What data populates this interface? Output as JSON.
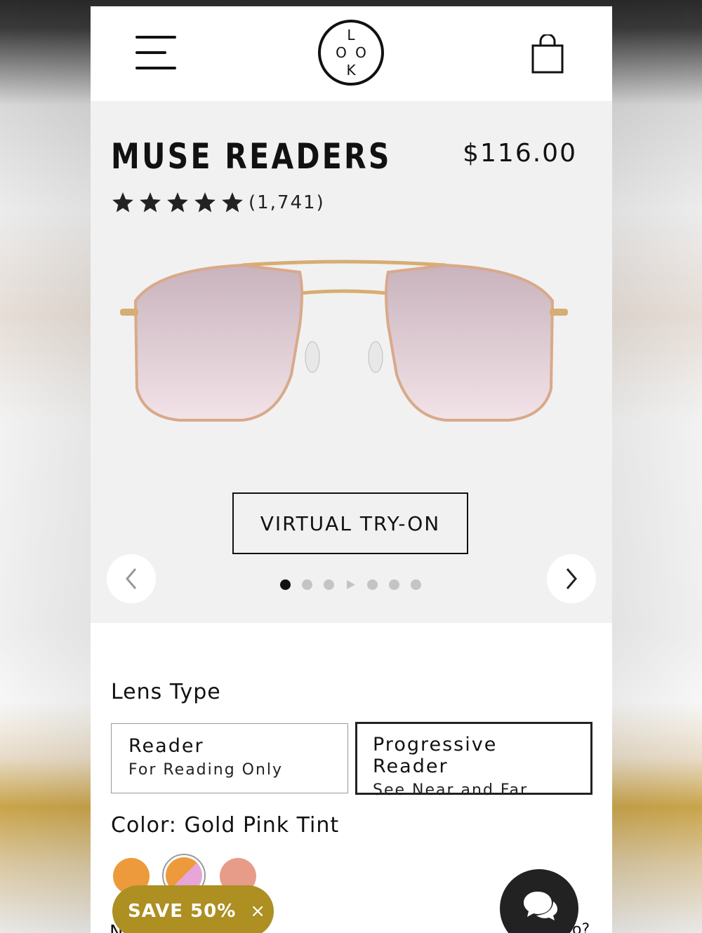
{
  "product": {
    "title": "MUSE READERS",
    "price": "$116.00",
    "rating_stars": 5,
    "review_count": "(1,741)"
  },
  "hero": {
    "tryon_label": "VIRTUAL TRY-ON",
    "carousel": {
      "slide_count": 7,
      "active_index": 0,
      "video_slide_index": 3
    }
  },
  "lens": {
    "label": "Lens Type",
    "options": [
      {
        "title": "Reader",
        "subtitle": "For Reading Only",
        "selected": false
      },
      {
        "title": "Progressive Reader",
        "subtitle": "See Near and Far",
        "selected": true
      }
    ]
  },
  "color": {
    "label": "Color:",
    "value": "Gold Pink Tint",
    "swatches": [
      {
        "name": "gold",
        "color": "#ec9a3c",
        "selected": false
      },
      {
        "name": "gold-pink-tint",
        "color": "#e7a6d7",
        "selected": true
      },
      {
        "name": "rose",
        "color": "#e79c8a",
        "selected": false
      }
    ]
  },
  "promo": {
    "label": "SAVE 50%",
    "close": "×"
  },
  "peek": {
    "left": "N",
    "right": "o?"
  },
  "icons": {
    "menu": "menu-icon",
    "logo_letters": [
      "L",
      "O",
      "O",
      "K"
    ],
    "cart": "shopping-bag-icon",
    "chat": "chat-bubbles-icon"
  },
  "colors": {
    "accent": "#ad8f22",
    "text": "#111111",
    "hero_bg": "#f1f1f1"
  }
}
